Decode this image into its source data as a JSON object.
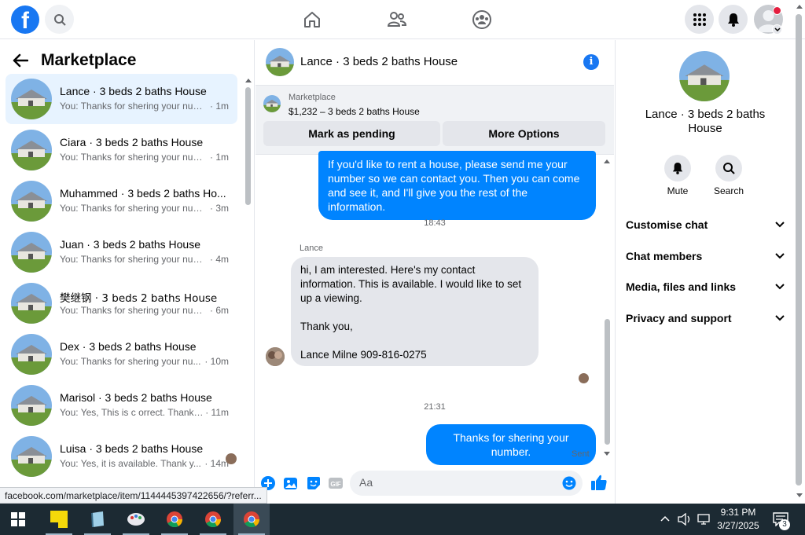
{
  "nav": {
    "logo": "f",
    "icons": [
      "search-icon",
      "home-icon",
      "friends-icon",
      "groups-icon",
      "menu-grid-icon",
      "notifications-icon",
      "profile-avatar"
    ]
  },
  "left": {
    "title": "Marketplace",
    "conversations": [
      {
        "name": "Lance · 3 beds 2 baths House",
        "snippet": "You: Thanks for shering your num...",
        "time": "· 1m"
      },
      {
        "name": "Ciara · 3 beds 2 baths House",
        "snippet": "You: Thanks for shering your num...",
        "time": "· 1m"
      },
      {
        "name": "Muhammed · 3 beds 2 baths Ho...",
        "snippet": "You: Thanks for shering your num...",
        "time": "· 3m"
      },
      {
        "name": "Juan · 3 beds 2 baths House",
        "snippet": "You: Thanks for shering your num...",
        "time": "· 4m"
      },
      {
        "name": "樊继钢 · 3 beds 2 baths House",
        "snippet": "You: Thanks for shering your num...",
        "time": "· 6m"
      },
      {
        "name": "Dex · 3 beds 2 baths House",
        "snippet": "You: Thanks for shering your nu...",
        "time": "· 10m"
      },
      {
        "name": "Marisol · 3 beds 2 baths House",
        "snippet": "You: Yes, This is c orrect. Thank y...",
        "time": "· 11m"
      },
      {
        "name": "Luisa · 3 beds 2 baths House",
        "snippet": "You: Yes, it is available. Thank y...",
        "time": "· 14m"
      }
    ]
  },
  "chat": {
    "title": "Lance · 3 beds 2 baths House",
    "listing_label": "Marketplace",
    "listing_price": "$1,232 – 3 beds 2 baths House",
    "mark_pending": "Mark as pending",
    "more_options": "More Options",
    "out_msg1": "If you'd like to rent a house, please send me your number so we can contact you. Then you can come and see it, and I'll give you the rest of the information.",
    "time1": "18:43",
    "sender": "Lance",
    "in_msg": "hi, I am interested. Here's my contact information. This is available. I would like to set up a viewing.\n\nThank you,\n\nLance Milne 909-816-0275",
    "time2": "21:31",
    "out_msg2": "Thanks for shering your number.",
    "sent_label": "Sent",
    "input_placeholder": "Aa"
  },
  "right": {
    "name": "Lance · 3 beds 2 baths House",
    "mute": "Mute",
    "search": "Search",
    "sections": [
      "Customise chat",
      "Chat members",
      "Media, files and links",
      "Privacy and support"
    ]
  },
  "status_url": "facebook.com/marketplace/item/1144445397422656/?referr...",
  "taskbar": {
    "time": "9:31 PM",
    "date": "3/27/2025",
    "notif_count": "3"
  },
  "colors": {
    "brand": "#1877f2",
    "bubble_out": "#0084ff",
    "active_row": "#e7f3ff"
  }
}
